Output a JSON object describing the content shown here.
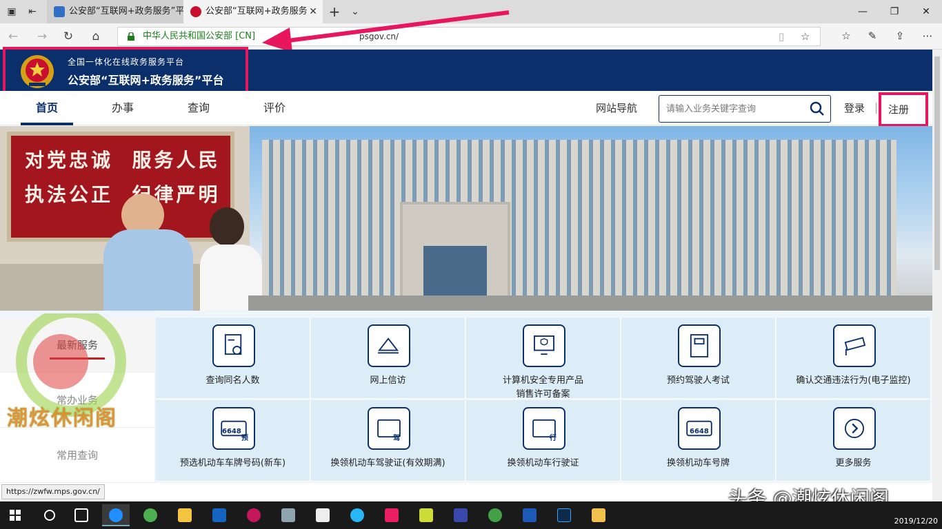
{
  "browser": {
    "tabs": [
      {
        "title": "公安部“互联网+政务服务”平",
        "icon": "site-favicon-blue"
      },
      {
        "title": "公安部“互联网+政务服务",
        "icon": "police-emblem-favicon"
      }
    ],
    "address": {
      "cert_label": "中华人民共和国公安部 [CN]",
      "url": "psgov.cn/"
    }
  },
  "header": {
    "subtitle": "全国一体化在线政务服务平台",
    "title": "公安部“互联网+政务服务”平台"
  },
  "nav": {
    "items": [
      "首页",
      "办事",
      "查询",
      "评价"
    ],
    "sitemap": "网站导航",
    "search_placeholder": "请输入业务关键字查询",
    "login": "登录",
    "register": "注册"
  },
  "banner": {
    "slogan_line1": "对党忠诚  服务人民",
    "slogan_line2": "执法公正  纪律严明"
  },
  "services": {
    "sidebar": [
      "最新服务",
      "常办业务",
      "常用查询"
    ],
    "row1": [
      {
        "label": "查询同名人数",
        "icon": "person-search-icon"
      },
      {
        "label": "网上信访",
        "icon": "envelope-pen-icon"
      },
      {
        "label": "计算机安全专用产品\n销售许可备案",
        "icon": "computer-shield-icon"
      },
      {
        "label": "预约驾驶人考试",
        "icon": "car-exam-icon"
      },
      {
        "label": "确认交通违法行为(电子监控)",
        "icon": "surveillance-camera-icon"
      }
    ],
    "row2": [
      {
        "label": "预选机动车车牌号码(新车)",
        "icon": "plate-6648-icon",
        "plate": "6648",
        "tag": "预"
      },
      {
        "label": "换领机动车驾驶证(有效期满)",
        "icon": "driver-license-icon",
        "tag": "驾"
      },
      {
        "label": "换领机动车行驶证",
        "icon": "vehicle-license-icon",
        "tag": "行"
      },
      {
        "label": "换领机动车号牌",
        "icon": "plate-icon",
        "plate": "6648"
      },
      {
        "label": "更多服务",
        "icon": "chevron-right-icon"
      }
    ]
  },
  "status_url": "https://zwfw.mps.gov.cn/",
  "watermark": {
    "text": "潮炫休闲阁",
    "toutiao": "头条 @潮炫休闲阁"
  },
  "taskbar": {
    "date": "2019/12/20"
  },
  "colors": {
    "header_blue": "#0b2f6b",
    "highlight": "#e8175d",
    "cert_green": "#1a7f1a"
  }
}
